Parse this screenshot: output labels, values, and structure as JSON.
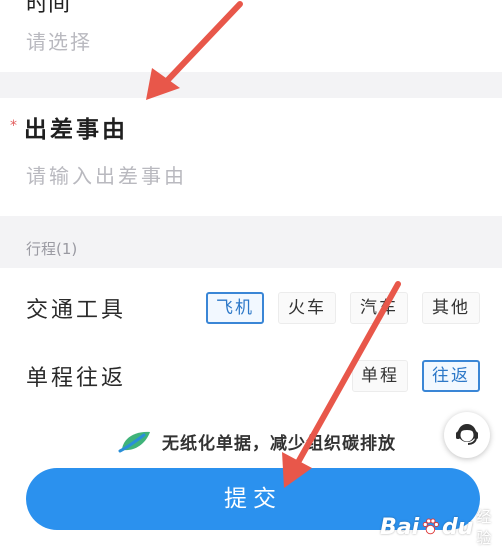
{
  "top_field": {
    "label_cut": "时间",
    "placeholder": "请选择"
  },
  "reason": {
    "required_mark": "*",
    "label": "出差事由",
    "placeholder": "请输入出差事由"
  },
  "itinerary": {
    "title": "行程(1)",
    "transport": {
      "label": "交通工具",
      "options": [
        "飞机",
        "火车",
        "汽车",
        "其他"
      ],
      "selected": "飞机"
    },
    "trip_type": {
      "label": "单程往返",
      "options": [
        "单程",
        "往返"
      ],
      "selected": "往返"
    }
  },
  "slogan": "无纸化单据，减少组织碳排放",
  "submit_label": "提交",
  "customer_service_icon": "headset-icon",
  "watermark": {
    "brand": "Bai",
    "brand_suffix": "du",
    "cn": "经验"
  },
  "colors": {
    "accent": "#2b91ee",
    "selected_border": "#3a86d6",
    "arrow": "#e8574a",
    "required": "#e25c5c"
  }
}
